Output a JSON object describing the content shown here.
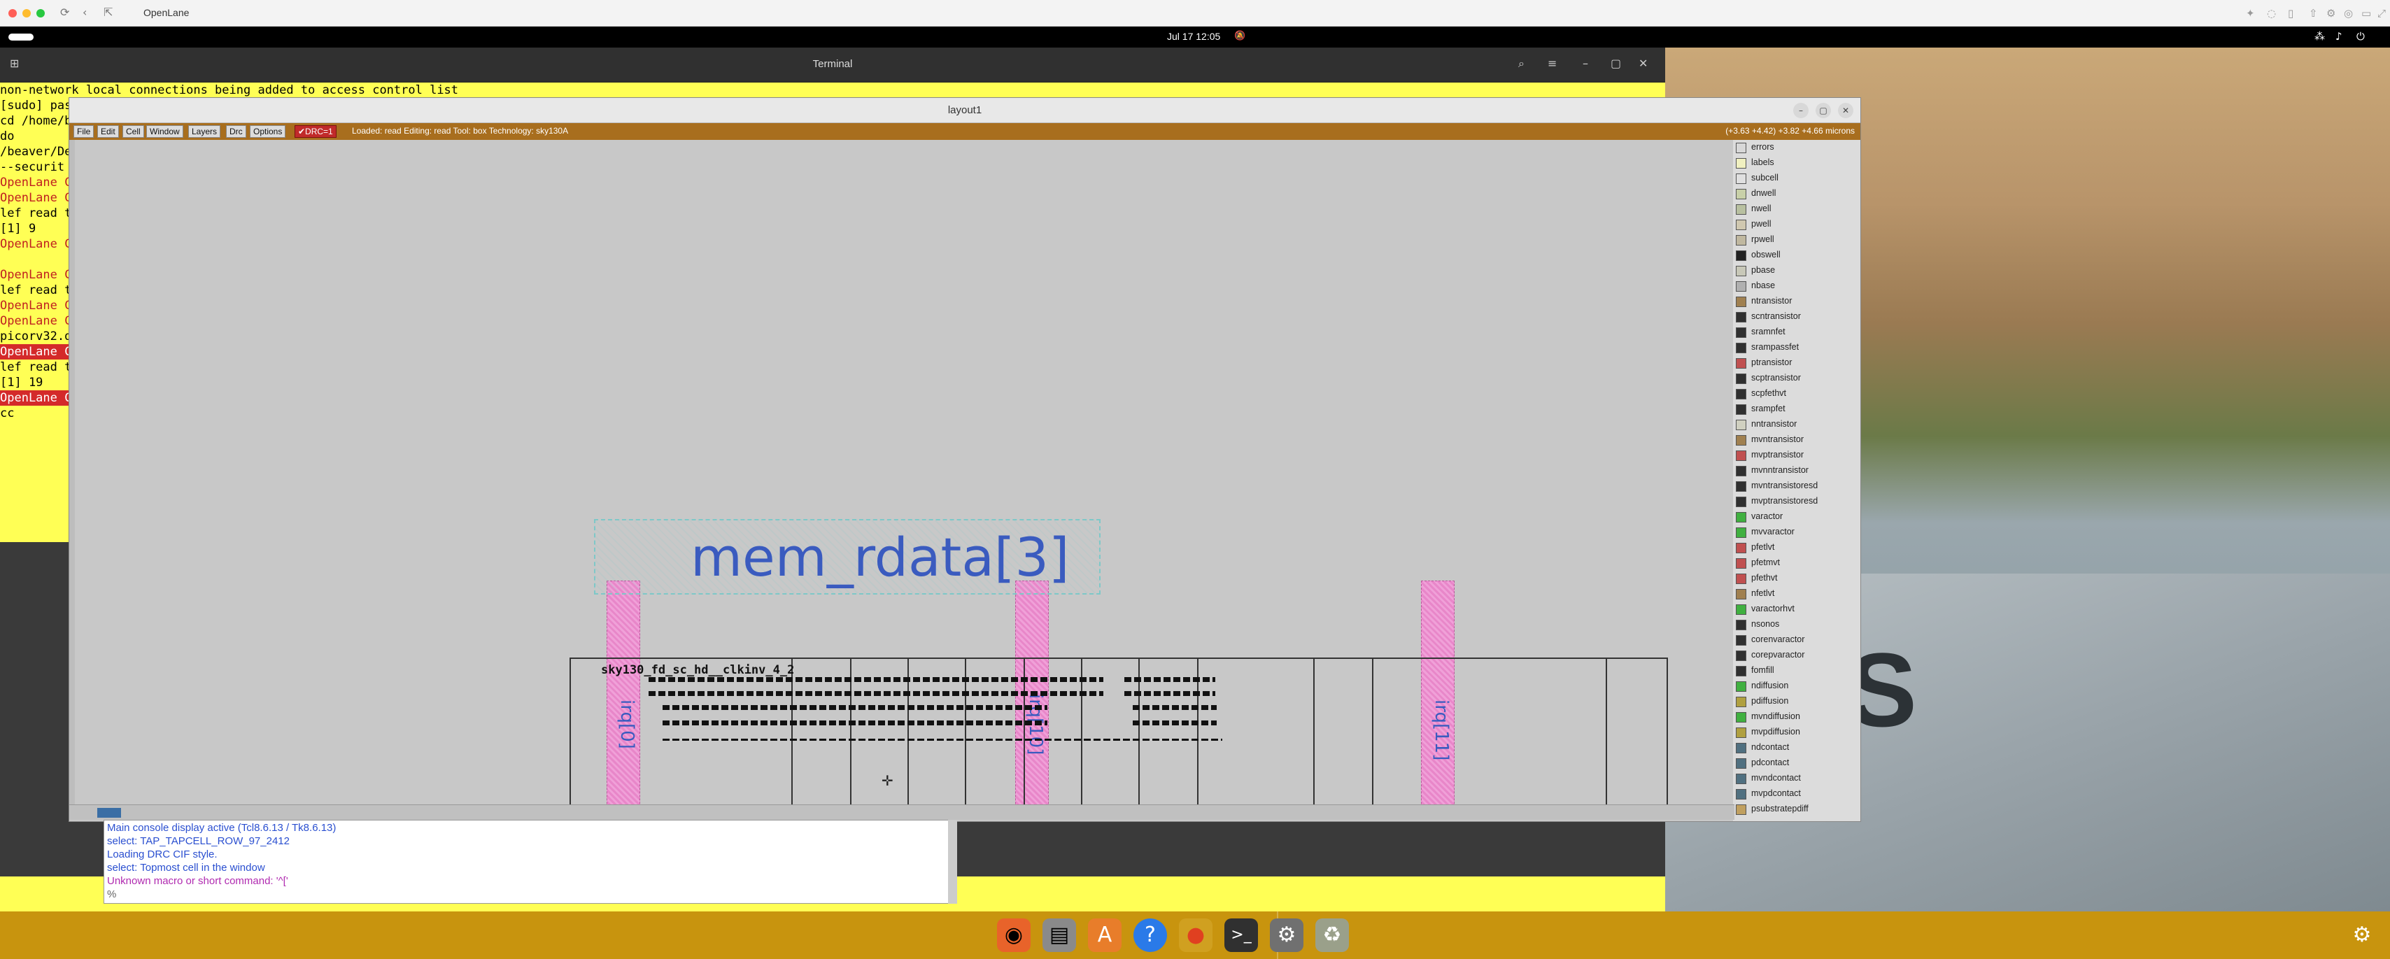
{
  "host": {
    "title": "OpenLane"
  },
  "system": {
    "clock": "Jul 17  12:05"
  },
  "terminal": {
    "title": "Terminal",
    "lines": [
      {
        "text": "non-network local connections being added to access control list",
        "red": false,
        "first": true
      },
      {
        "text": "[sudo] pas",
        "red": false
      },
      {
        "text": "cd /home/b",
        "red": false
      },
      {
        "text": "         do",
        "red": false
      },
      {
        "text": "/beaver/De",
        "red": false
      },
      {
        "text": "--securit",
        "red": false
      },
      {
        "text": "OpenLane C",
        "red": false,
        "redtext": true
      },
      {
        "text": "OpenLane C",
        "red": false,
        "redtext": true
      },
      {
        "text": "lef read t",
        "red": false
      },
      {
        "text": "[1] 9",
        "red": false
      },
      {
        "text": "OpenLane C",
        "red": false,
        "redtext": true
      },
      {
        "text": "",
        "red": false
      },
      {
        "text": "OpenLane C",
        "red": false,
        "redtext": true
      },
      {
        "text": "lef read t",
        "red": false
      },
      {
        "text": "OpenLane C",
        "red": false,
        "redtext": true
      },
      {
        "text": "OpenLane C",
        "red": false,
        "redtext": true
      },
      {
        "text": "picorv32.d",
        "red": false
      },
      {
        "text": "OpenLane C",
        "red": true
      },
      {
        "text": "lef read t",
        "red": false
      },
      {
        "text": "[1] 19",
        "red": false
      },
      {
        "text": "OpenLane C",
        "red": true
      },
      {
        "text": "cc",
        "red": false
      }
    ]
  },
  "magic": {
    "title": "layout1",
    "menu": [
      "File",
      "Edit",
      "Cell",
      "Window",
      "Layers",
      "Drc",
      "Options"
    ],
    "drc_label": "✔DRC=1",
    "status": "Loaded: read  Editing: read  Tool: box   Technology: sky130A",
    "coords": "(+3.63 +4.42) +3.82 +4.66 microns",
    "big_label": "mem_rdata[3]",
    "vertical_labels": [
      "irq[0]",
      "irq[10]",
      "irq[11]"
    ],
    "cell_name": "sky130_fd_sc_hd__clkinv_4_2",
    "layers": [
      {
        "name": "errors",
        "color": "#d8d8d8"
      },
      {
        "name": "labels",
        "color": "#f0f0c0"
      },
      {
        "name": "subcell",
        "color": "#e0e0e0"
      },
      {
        "name": "dnwell",
        "color": "#c8d0a8"
      },
      {
        "name": "nwell",
        "color": "#b8c0a0"
      },
      {
        "name": "pwell",
        "color": "#d0c8b0"
      },
      {
        "name": "rpwell",
        "color": "#c0b8a0"
      },
      {
        "name": "obswell",
        "color": "#222222"
      },
      {
        "name": "pbase",
        "color": "#c8c8b8"
      },
      {
        "name": "nbase",
        "color": "#b0b0b0"
      },
      {
        "name": "ntransistor",
        "color": "#a08050"
      },
      {
        "name": "scntransistor",
        "color": "#303030"
      },
      {
        "name": "sramnfet",
        "color": "#303030"
      },
      {
        "name": "srampassfet",
        "color": "#303030"
      },
      {
        "name": "ptransistor",
        "color": "#c05050"
      },
      {
        "name": "scptransistor",
        "color": "#303030"
      },
      {
        "name": "scpfethvt",
        "color": "#303030"
      },
      {
        "name": "srampfet",
        "color": "#303030"
      },
      {
        "name": "nntransistor",
        "color": "#d0d0c0"
      },
      {
        "name": "mvntransistor",
        "color": "#a08050"
      },
      {
        "name": "mvptransistor",
        "color": "#c05050"
      },
      {
        "name": "mvnntransistor",
        "color": "#303030"
      },
      {
        "name": "mvntransistoresd",
        "color": "#303030"
      },
      {
        "name": "mvptransistoresd",
        "color": "#303030"
      },
      {
        "name": "varactor",
        "color": "#40b040"
      },
      {
        "name": "mvvaractor",
        "color": "#40b040"
      },
      {
        "name": "pfetlvt",
        "color": "#c05050"
      },
      {
        "name": "pfetmvt",
        "color": "#c05050"
      },
      {
        "name": "pfethvt",
        "color": "#c05050"
      },
      {
        "name": "nfetlvt",
        "color": "#a08050"
      },
      {
        "name": "varactorhvt",
        "color": "#40b040"
      },
      {
        "name": "nsonos",
        "color": "#303030"
      },
      {
        "name": "corenvaractor",
        "color": "#303030"
      },
      {
        "name": "corepvaractor",
        "color": "#303030"
      },
      {
        "name": "fomfill",
        "color": "#303030"
      },
      {
        "name": "ndiffusion",
        "color": "#40b040"
      },
      {
        "name": "pdiffusion",
        "color": "#b0a040"
      },
      {
        "name": "mvndiffusion",
        "color": "#40b040"
      },
      {
        "name": "mvpdiffusion",
        "color": "#b0a040"
      },
      {
        "name": "ndcontact",
        "color": "#507080"
      },
      {
        "name": "pdcontact",
        "color": "#507080"
      },
      {
        "name": "mvndcontact",
        "color": "#507080"
      },
      {
        "name": "mvpdcontact",
        "color": "#507080"
      },
      {
        "name": "psubstratepdiff",
        "color": "#c0a060"
      }
    ]
  },
  "console": {
    "lines": [
      {
        "text": "Main console display active (Tcl8.6.13 / Tk8.6.13)",
        "color": "#2a4fd0"
      },
      {
        "text": "select: TAP_TAPCELL_ROW_97_2412",
        "color": "#2a4fd0"
      },
      {
        "text": "Loading DRC CIF style.",
        "color": "#2a4fd0"
      },
      {
        "text": "select: Topmost cell in the window",
        "color": "#2a4fd0"
      },
      {
        "text": "Unknown macro or short command: '^['",
        "color": "#b02ab0"
      },
      {
        "text": "%",
        "color": "#666666"
      }
    ]
  },
  "dock": {
    "items": [
      "firefox-icon",
      "files-icon",
      "app-store-icon",
      "help-icon",
      "media-icon",
      "terminal-icon",
      "settings-icon",
      "trash-icon"
    ]
  }
}
